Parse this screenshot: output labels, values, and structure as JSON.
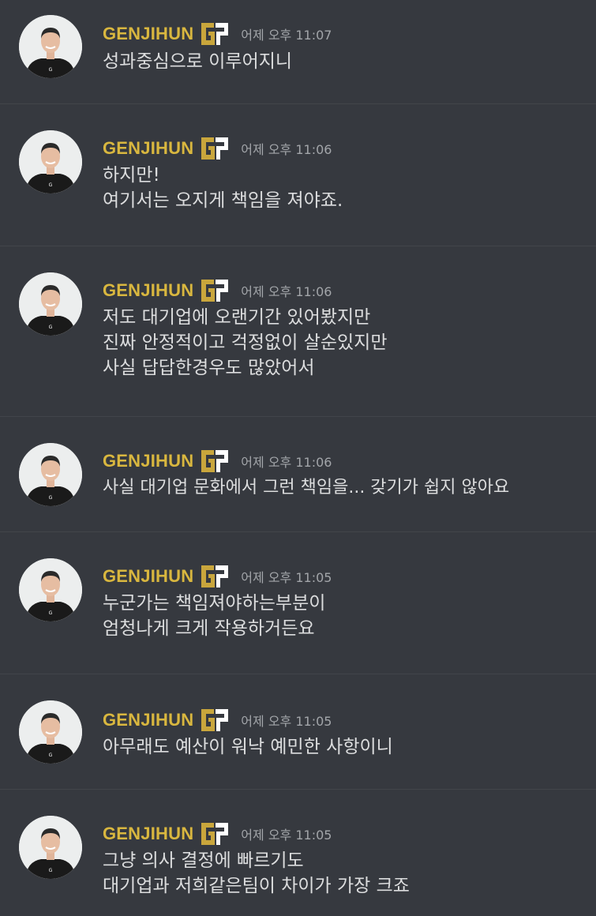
{
  "channel": {
    "messages": [
      {
        "author": "GENJIHUN",
        "timestamp": "어제 오후 11:07",
        "lines": [
          "성과중심으로 이루어지니"
        ]
      },
      {
        "author": "GENJIHUN",
        "timestamp": "어제 오후 11:06",
        "lines": [
          "하지만!",
          "여기서는 오지게 책임을 져야죠."
        ]
      },
      {
        "author": "GENJIHUN",
        "timestamp": "어제 오후 11:06",
        "lines": [
          "저도 대기업에 오랜기간 있어봤지만",
          "진짜 안정적이고 걱정없이 살순있지만",
          "사실 답답한경우도 많았어서"
        ]
      },
      {
        "author": "GENJIHUN",
        "timestamp": "어제 오후 11:06",
        "lines": [
          "사실 대기업 문화에서 그런 책임을... 갖기가 쉽지 않아요"
        ]
      },
      {
        "author": "GENJIHUN",
        "timestamp": "어제 오후 11:05",
        "lines": [
          "누군가는 책임져야하는부분이",
          "엄청나게 크게 작용하거든요"
        ]
      },
      {
        "author": "GENJIHUN",
        "timestamp": "어제 오후 11:05",
        "lines": [
          "아무래도 예산이 워낙 예민한 사항이니"
        ]
      },
      {
        "author": "GENJIHUN",
        "timestamp": "어제 오후 11:05",
        "lines": [
          "그냥 의사 결정에 빠르기도",
          "대기업과 저희같은팀이 차이가 가장 크죠"
        ]
      }
    ]
  },
  "colors": {
    "background": "#36393f",
    "username": "#d9b73f",
    "timestamp": "#a3a6aa",
    "text": "#dcddde",
    "divider": "#42454a"
  },
  "icons": {
    "avatar": "profile-photo",
    "badge": "gen-g-logo-icon"
  }
}
